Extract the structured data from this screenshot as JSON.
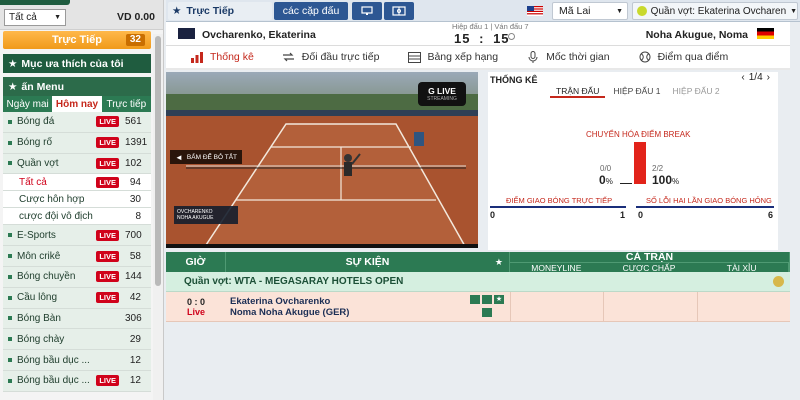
{
  "account": {
    "filter_value": "Tất cả",
    "balance": "VD 0.00"
  },
  "live_button": {
    "label": "Trực Tiếp",
    "count": "32"
  },
  "favorites": {
    "label": "Mục ưa thích của tôi"
  },
  "menu": {
    "label": "ấn Menu"
  },
  "sidebar_tabs": [
    "Ngày mai",
    "Hôm nay",
    "Trực tiếp"
  ],
  "sports": [
    {
      "name": "Bóng đá",
      "live": "LIVE",
      "count": "561"
    },
    {
      "name": "Bóng rổ",
      "live": "LIVE",
      "count": "1391"
    },
    {
      "name": "Quần vợt",
      "live": "LIVE",
      "count": "102"
    }
  ],
  "tennis_sub": [
    {
      "name": "Tất cả",
      "live": "LIVE",
      "count": "94"
    },
    {
      "name": "Cược hỗn hợp",
      "count": "30"
    },
    {
      "name": "cược đội vô địch",
      "count": "8"
    }
  ],
  "sports_more": [
    {
      "name": "E-Sports",
      "live": "LIVE",
      "count": "700"
    },
    {
      "name": "Môn crikê",
      "live": "LIVE",
      "count": "58"
    },
    {
      "name": "Bóng chuyền",
      "live": "LIVE",
      "count": "144"
    },
    {
      "name": "Cầu lông",
      "live": "LIVE",
      "count": "42"
    },
    {
      "name": "Bóng Bàn",
      "count": "306"
    },
    {
      "name": "Bóng chày",
      "count": "29"
    },
    {
      "name": "Bóng bầu dục ...",
      "count": "12"
    },
    {
      "name": "Bóng bầu dục ...",
      "live": "LIVE",
      "count": "12"
    }
  ],
  "topbar": {
    "live_label": "Trực Tiếp",
    "pair_label": "các cặp đấu",
    "timezone": "Mã Lai",
    "match_select": "Quần vợt: Ekaterina Ovcharenko"
  },
  "scoreboard": {
    "home": "Ovcharenko, Ekaterina",
    "away": "Noha Akugue, Noma",
    "period": "Hiệp đấu 1 | Ván đấu 7",
    "home_score": "15",
    "separator": ":",
    "away_score": "15"
  },
  "nav_tabs": [
    "Thống kê",
    "Đối đầu trực tiếp",
    "Bảng xếp hạng",
    "Mốc thời gian",
    "Điểm qua điểm"
  ],
  "video": {
    "brand": "G LIVE",
    "brand_sub": "STREAMING",
    "mute_label": "BẤM ĐỂ BỎ TẮT",
    "p1": "OVCHARENKO",
    "p2": "NOHA AKUGUE"
  },
  "stats": {
    "title": "THỐNG KÊ",
    "page": "1/4",
    "tabs": [
      "TRẬN ĐẤU",
      "HIỆP ĐẤU 1",
      "HIỆP ĐẤU 2"
    ],
    "break_label": "CHUYỂN HÓA ĐIỂM BREAK",
    "left_frac": "0/0",
    "left_pct": "0",
    "left_pct_unit": "%",
    "right_frac": "2/2",
    "right_pct": "100",
    "right_pct_unit": "%",
    "left_value": 0,
    "right_value": 100,
    "serve_label": "ĐIỂM GIAO BÓNG TRỰC TIẾP",
    "serve_left": "0",
    "serve_right": "1",
    "double_fault_label": "SỐ LỖI HAI LẦN GIAO BÓNG HỎNG",
    "df_left": "0",
    "df_right": "6"
  },
  "table": {
    "col_time": "GIỜ",
    "col_event": "SỰ KIỆN",
    "col_full": "CẢ TRẬN",
    "sub_cols": [
      "MONEYLINE",
      "CƯỢC CHẤP",
      "TÀI XỈU"
    ],
    "league": "Quần vợt: WTA - MEGASARAY HOTELS OPEN",
    "match_score": "0 : 0",
    "match_status": "Live",
    "home": "Ekaterina Ovcharenko",
    "away": "Noma Noha Akugue (GER)"
  },
  "colors": {
    "accent_green": "#2c7a53",
    "live_red": "#d0021b",
    "orange": "#f5a623",
    "navy": "#2d5793"
  }
}
